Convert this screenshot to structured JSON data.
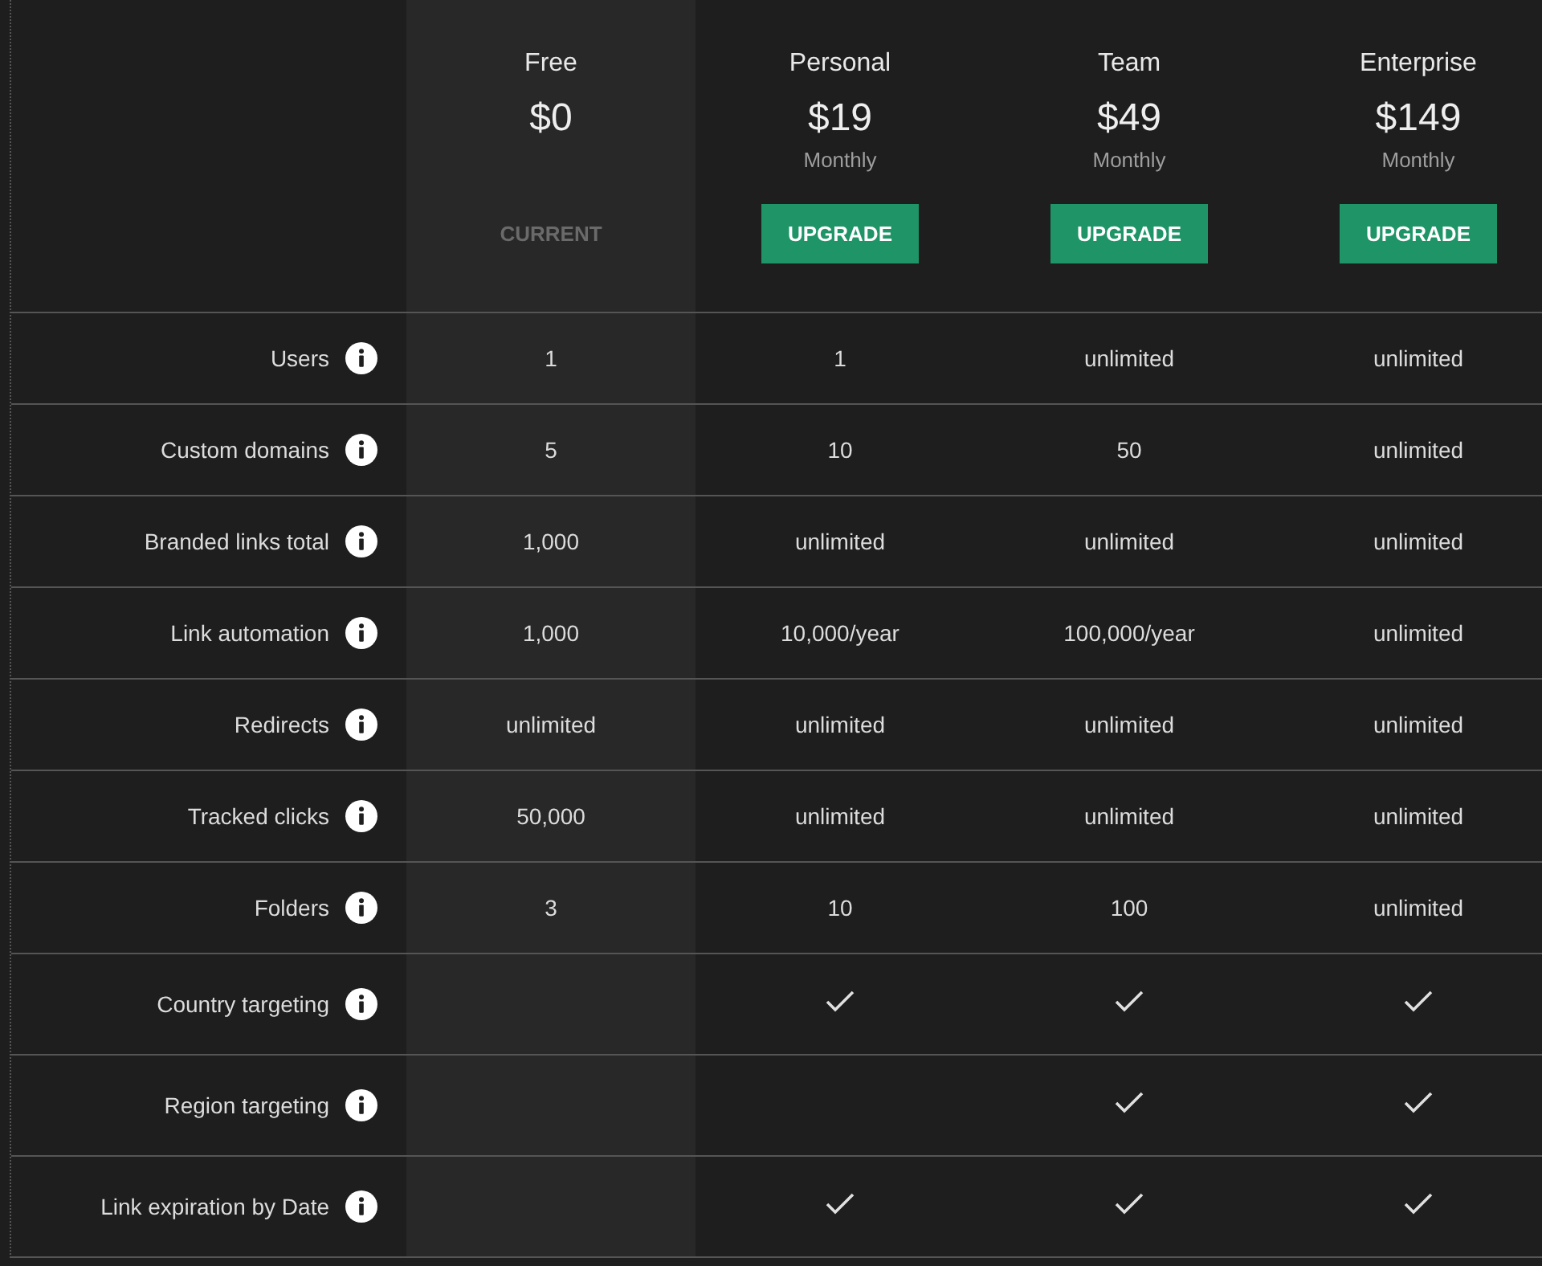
{
  "plans": [
    {
      "name": "Free",
      "price": "$0",
      "action": "CURRENT",
      "current": true
    },
    {
      "name": "Personal",
      "price": "$19",
      "period": "Monthly",
      "action": "UPGRADE",
      "current": false
    },
    {
      "name": "Team",
      "price": "$49",
      "period": "Monthly",
      "action": "UPGRADE",
      "current": false
    },
    {
      "name": "Enterprise",
      "price": "$149",
      "period": "Monthly",
      "action": "UPGRADE",
      "current": false
    }
  ],
  "features": [
    {
      "label": "Users",
      "kind": "text",
      "values": [
        "1",
        "1",
        "unlimited",
        "unlimited"
      ]
    },
    {
      "label": "Custom domains",
      "kind": "text",
      "values": [
        "5",
        "10",
        "50",
        "unlimited"
      ]
    },
    {
      "label": "Branded links total",
      "kind": "text",
      "values": [
        "1,000",
        "unlimited",
        "unlimited",
        "unlimited"
      ]
    },
    {
      "label": "Link automation",
      "kind": "text",
      "values": [
        "1,000",
        "10,000/year",
        "100,000/year",
        "unlimited"
      ]
    },
    {
      "label": "Redirects",
      "kind": "text",
      "values": [
        "unlimited",
        "unlimited",
        "unlimited",
        "unlimited"
      ]
    },
    {
      "label": "Tracked clicks",
      "kind": "text",
      "values": [
        "50,000",
        "unlimited",
        "unlimited",
        "unlimited"
      ]
    },
    {
      "label": "Folders",
      "kind": "text",
      "values": [
        "3",
        "10",
        "100",
        "unlimited"
      ]
    },
    {
      "label": "Country targeting",
      "kind": "check",
      "checks": [
        {
          "checked": false
        },
        {
          "checked": true
        },
        {
          "checked": true
        },
        {
          "checked": true
        }
      ]
    },
    {
      "label": "Region targeting",
      "kind": "check",
      "checks": [
        {
          "checked": false
        },
        {
          "checked": false
        },
        {
          "checked": true
        },
        {
          "checked": true
        }
      ]
    },
    {
      "label": "Link expiration by Date",
      "kind": "check",
      "checks": [
        {
          "checked": false
        },
        {
          "checked": true
        },
        {
          "checked": true
        },
        {
          "checked": true
        }
      ]
    }
  ]
}
